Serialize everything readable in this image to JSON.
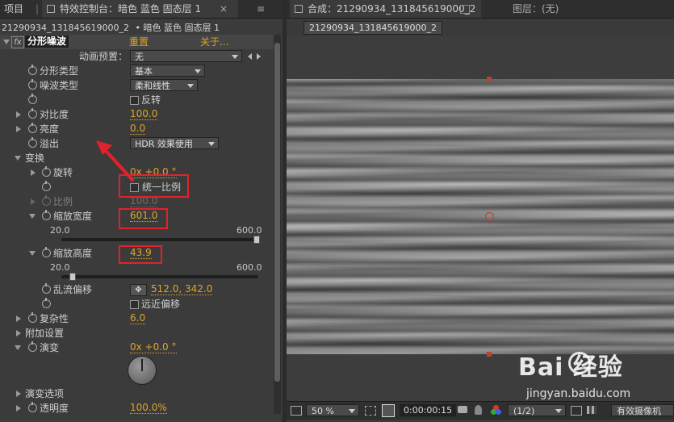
{
  "left_tabs": {
    "project": "项目",
    "effects_control": "特效控制台：暗色 蓝色 固态层 1",
    "close": "×",
    "menu": "≡"
  },
  "layer_path": {
    "comp": "21290934_131845619000_2",
    "layer": "• 暗色 蓝色 固态层 1"
  },
  "effect": {
    "fx": "fx",
    "name": "分形噪波",
    "reset": "重置",
    "about": "关于..."
  },
  "props": {
    "anim_preset_label": "动画预置：",
    "anim_preset_value": "无",
    "fractal_type_label": "分形类型",
    "fractal_type_value": "基本",
    "noise_type_label": "噪波类型",
    "noise_type_value": "柔和线性",
    "invert_label": "反转",
    "contrast_label": "对比度",
    "contrast_value": "100.0",
    "brightness_label": "亮度",
    "brightness_value": "0.0",
    "overflow_label": "溢出",
    "overflow_value": "HDR 效果使用",
    "transform_label": "变换",
    "rotation_label": "旋转",
    "rotation_value": "0x +0.0 °",
    "uniform_scale_label": "统一比例",
    "scale_label": "比例",
    "scale_value": "100.0",
    "scale_width_label": "缩放宽度",
    "scale_width_value": "601.0",
    "scale_width_min": "20.0",
    "scale_width_max": "600.0",
    "scale_width_fraction": 1.0,
    "scale_height_label": "缩放高度",
    "scale_height_value": "43.9",
    "scale_height_min": "20.0",
    "scale_height_max": "600.0",
    "scale_height_fraction": 0.041,
    "turb_offset_label": "乱流偏移",
    "turb_offset_value": "512.0, 342.0",
    "perspective_offset_label": "远近偏移",
    "complexity_label": "复杂性",
    "complexity_value": "6.0",
    "sub_settings_label": "附加设置",
    "evolution_label": "演变",
    "evolution_value": "0x +0.0 °",
    "evolution_options_label": "演变选项",
    "opacity_label": "透明度",
    "opacity_value": "100.0%"
  },
  "right_tabs": {
    "composition": "合成：21290934_131845619000_2",
    "layer": "图层：(无)",
    "comp_chip": "21290934_131845619000_2"
  },
  "viewer_toolbar": {
    "zoom": "50 %",
    "timecode": "0:00:00:15",
    "resolution": "(1/2)",
    "camera": "有效摄像机"
  },
  "watermark": {
    "brand": "Bai 经验",
    "url": "jingyan.baidu.com"
  },
  "colors": {
    "value_orange": "#e0a426",
    "annotation_red": "#e2222a",
    "panel_bg": "#3b3b3b"
  }
}
